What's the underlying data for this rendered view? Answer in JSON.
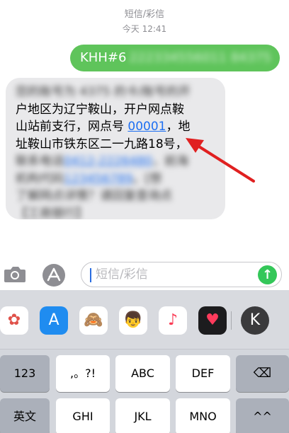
{
  "header": {
    "title": "短信/彩信",
    "time": "今天 12:41"
  },
  "messages": {
    "outgoing": {
      "text": "KHH#6",
      "redacted": "222334556011 84375"
    },
    "incoming": {
      "redacted_line_1": "您的账号为 4375 的卡/账号的开",
      "line_2": "户地区为辽宁鞍山，开户网点鞍",
      "line_3": "山站前支行，网点号",
      "branch_code": "00001",
      "line_3_tail": "，地",
      "line_4": "址鞍山市铁东区二一九路18号，",
      "redacted_line_5_prefix": "联系电话",
      "redacted_line_5_link": "0412-2226480",
      "redacted_line_5_tail": "，前海",
      "redacted_line_6_prefix": "机构代码",
      "redacted_line_6_link": "123456789",
      "redacted_line_6_tail": "。[想",
      "redacted_line_7": "了解网点详情？请回复查询点",
      "redacted_line_8": "【工商银行】"
    }
  },
  "composer": {
    "placeholder": "短信/彩信",
    "send_symbol": "↑"
  },
  "apps": [
    {
      "name": "photos",
      "glyph": "✿",
      "bg": "#ffffff",
      "color": "#e0524a"
    },
    {
      "name": "app-store",
      "glyph": "A",
      "bg": "#1f8cf0",
      "color": "#ffffff"
    },
    {
      "name": "monkey",
      "glyph": "🙈",
      "bg": "#ffffff",
      "color": "#8a5a2b"
    },
    {
      "name": "memoji",
      "glyph": "👦",
      "bg": "#ffffff",
      "color": "#c47a3a"
    },
    {
      "name": "music",
      "glyph": "♪",
      "bg": "#ffffff",
      "color": "#fa3c55"
    },
    {
      "name": "heart",
      "glyph": "♥",
      "bg": "#1c1c1e",
      "color": "#ff3b5c"
    },
    {
      "name": "k-app",
      "glyph": "K",
      "bg": "#3a3a3c",
      "color": "#ffffff"
    }
  ],
  "keyboard": {
    "row1": [
      "123",
      ",。?!",
      "ABC",
      "DEF",
      "⌫"
    ],
    "row2": [
      "英文",
      "GHI",
      "JKL",
      "MNO",
      "^^"
    ]
  }
}
